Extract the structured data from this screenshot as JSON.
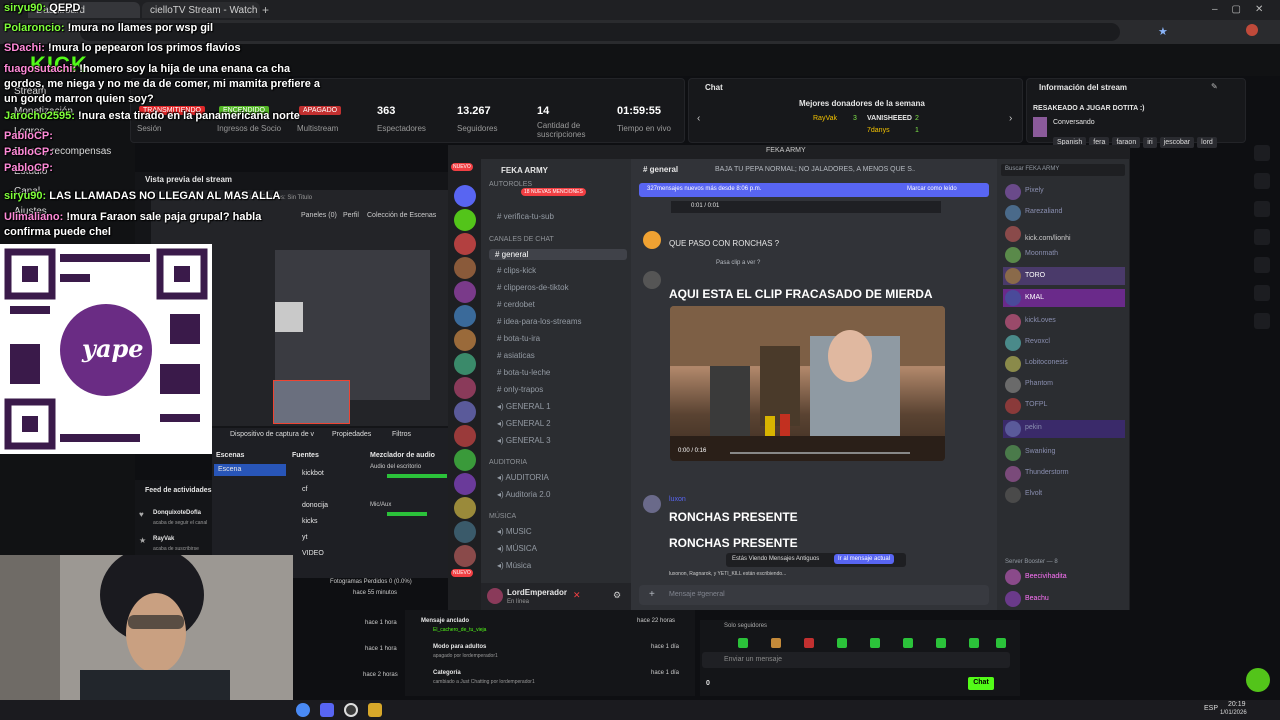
{
  "browser": {
    "tab1_title": "Dashboard",
    "tab2_title": "cielloTV Stream - Watch Live on",
    "new_tab": "+"
  },
  "overlay_chat": [
    {
      "user": "siryu90:",
      "text": "QEPD"
    },
    {
      "user": "Polaroncio:",
      "text": "!mura no llames por wsp gil"
    },
    {
      "user": "SDachi:",
      "text": "!mura lo pepearon los primos flavios"
    },
    {
      "user": "fuagosutachi:",
      "text": "!homero soy la hija de una enana ca cha gordos, me niega y no me da de comer, mi mamita prefiere a un gordo marron quien soy?"
    },
    {
      "user": "Jarocho2595:",
      "text": "!nura esta tirado en la panamericana norte"
    },
    {
      "user": "PabloCP:",
      "text": ""
    },
    {
      "user": "PabloCP:",
      "text": ""
    },
    {
      "user": "PabloCP:",
      "text": ""
    },
    {
      "user": "siryu90:",
      "text": "LAS LLAMADAS NO LLEGAN AL MAS ALLA"
    },
    {
      "user": "Ulimaliano:",
      "text": "!mura Faraon sale paja grupal? habla confirma puede chel"
    }
  ],
  "kick": {
    "logo": "KICK",
    "sidebar": [
      "Stream",
      "Monetización",
      "Logros",
      "Drops y recompensas",
      "Estudio",
      "Canal",
      "Ajustes"
    ],
    "badges": [
      "TRANSMITIENDO",
      "ENCENDIDO",
      "APAGADO"
    ],
    "badge_labels": [
      "Sesión",
      "Ingresos de Socio",
      "Multistream"
    ],
    "stats": [
      {
        "value": "363",
        "label": "Espectadores"
      },
      {
        "value": "13.267",
        "label": "Seguidores"
      },
      {
        "value": "14",
        "label": "Cantidad de suscripciones"
      },
      {
        "value": "01:59:55",
        "label": "Tiempo en vivo"
      }
    ],
    "chat_title": "Chat",
    "donors_title": "Mejores donadores de la semana",
    "donors": [
      {
        "name": "RayVak",
        "n": "3"
      },
      {
        "name": "VANISHEEED",
        "n": "2"
      },
      {
        "name": "7danys",
        "n": "1"
      }
    ],
    "info_title": "Información del stream",
    "stream_title": "RESAKEADO A JUGAR DOTITA :)",
    "category": "Conversando",
    "tags": [
      "Spanish",
      "fera",
      "faraon",
      "iri",
      "jescobar",
      "lord",
      "lorde"
    ],
    "preview_title": "Vista previa del stream",
    "feed_title": "Feed de actividades",
    "feed": [
      {
        "name": "DonquixoteDofla",
        "sub": "acaba de seguir el canal"
      },
      {
        "name": "RayVak",
        "sub": "acaba de suscribirse"
      }
    ],
    "bottom_rows": [
      {
        "title": "",
        "sub": "hace 55 minutos",
        "time": ""
      },
      {
        "title": "",
        "sub": "",
        "time": "hace 1 hora"
      },
      {
        "title": "Mensaje anclado",
        "sub": "El_cachero_de_tu_vieja",
        "time": "hace 22 horas"
      },
      {
        "title": "Modo para adultos",
        "sub": "apagado por lordemperador1",
        "time": "hace 1 día"
      },
      {
        "title": "Categoría",
        "sub": "cambiado a Just Chatting por lordemperador1",
        "time": "hace 1 día"
      }
    ],
    "bottom_times_left": [
      "hace 1 hora",
      "hace 1 hora",
      "hace 2 horas"
    ],
    "solo_seguidores": "Solo seguidores",
    "chat_placeholder": "Enviar un mensaje",
    "chat_button": "Chat",
    "viewer_count": "0"
  },
  "discord": {
    "server_name": "FEKA ARMY",
    "window_title": "FEKA ARMY",
    "new_label": "NUEVO",
    "mentions": "18 NUEVAS MENCIONES",
    "channels": [
      {
        "cat": "AUTOROLES"
      },
      {
        "name": "verifica-tu-sub"
      },
      {
        "cat": "CANALES DE CHAT"
      },
      {
        "name": "general",
        "active": true
      },
      {
        "name": "clips-kick"
      },
      {
        "name": "clipperos-de-tiktok"
      },
      {
        "name": "cerdobet"
      },
      {
        "name": "idea-para-los-streams"
      },
      {
        "name": "bota-tu-ira"
      },
      {
        "name": "asiaticas"
      },
      {
        "name": "bota-tu-leche"
      },
      {
        "name": "only-trapos"
      },
      {
        "name": "GENERAL 1"
      },
      {
        "name": "GENERAL 2"
      },
      {
        "name": "GENERAL 3"
      },
      {
        "cat": "AUDITORIA"
      },
      {
        "name": "AUDITORIA"
      },
      {
        "name": "Auditoria 2.0"
      },
      {
        "cat": "MÚSICA"
      },
      {
        "name": "MUSIC"
      },
      {
        "name": "MÚSICA"
      },
      {
        "name": "Música"
      }
    ],
    "user_name": "LordEmperador",
    "user_status": "En línea",
    "channel_header": "general",
    "topic": "BAJA TU PEPA NORMAL; NO JALADORES, A MENOS QUE S...",
    "new_banner": "327mensajes nuevos más desde 8:06 p.m.",
    "mark_read": "Marcar como leído",
    "msg1_text": "QUE PASO CON RONCHAS ?",
    "reply_text": "Pasa clip a ver ?",
    "msg2_text": "AQUI ESTA EL CLIP FRACASADO DE MIERDA",
    "video_time": "0:00 / 0:16",
    "top_video_time": "0:01 / 0:01",
    "reactions": "2",
    "msg3_user": "luxon",
    "msg3_line1": "RONCHAS PRESENTE",
    "msg3_line2": "RONCHAS PRESENTE",
    "old_msgs": "Estás Viendo Mensajes Antiguos",
    "jump_now": "Ir al mensaje actual",
    "typing": "luxonon, Ragnarok, y YETI_KILL están escribiendo...",
    "composer_placeholder": "Mensaje #general",
    "search_placeholder": "Buscar FEKA ARMY",
    "members": [
      "Pixely",
      "Rarezaliand",
      "kick.com/lionhi",
      "Moonmath",
      "TORO",
      "KMAL",
      "kickLoves",
      "Revoxcl",
      "Lobitoconesis",
      "Phantom",
      "TOFPL",
      "pekin",
      "Swanking",
      "Thunderstorm",
      "Elvolt",
      "Beecivihadita",
      "Beachu"
    ],
    "booster_label": "Server Booster — 8"
  },
  "obs": {
    "scenes_title": "Escenas",
    "scene": "Escena",
    "sources_title": "Fuentes",
    "sources": [
      "kickbot",
      "cf",
      "donocija",
      "kicks",
      "yt",
      "VIDEO"
    ],
    "mixer_title": "Mezclador de audio",
    "mixer_items": [
      "Audio del escritorio",
      "Mic/Aux"
    ],
    "frames": "Fotogramas Perdidos 0 (0.0%)",
    "device": "Dispositivo de captura de v",
    "props": "Propiedades",
    "filters": "Filtros",
    "menu": [
      "Perfil",
      "Colección de Escenas"
    ],
    "tab_title": "Sin Titulo - Escenas: Sin Titulo",
    "panels": "Paneles (0)"
  },
  "taskbar": {
    "lang": "ESP",
    "time": "20:19",
    "date": "1/01/2026"
  }
}
